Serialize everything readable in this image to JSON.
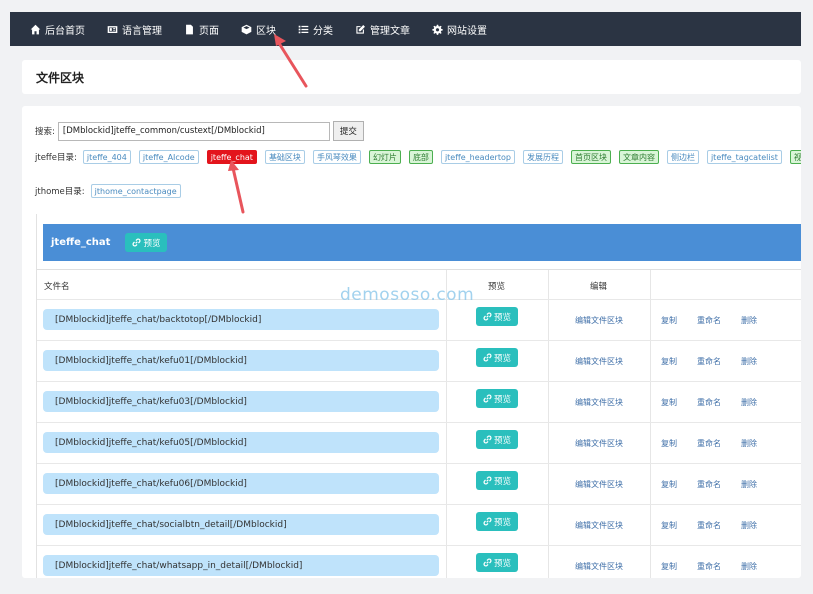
{
  "nav": [
    {
      "label": "后台首页",
      "icon": "home-icon"
    },
    {
      "label": "语言管理",
      "icon": "language-icon"
    },
    {
      "label": "页面",
      "icon": "page-icon"
    },
    {
      "label": "区块",
      "icon": "cube-icon"
    },
    {
      "label": "分类",
      "icon": "list-icon"
    },
    {
      "label": "管理文章",
      "icon": "edit-icon"
    },
    {
      "label": "网站设置",
      "icon": "gear-icon"
    }
  ],
  "page_title": "文件区块",
  "search": {
    "label": "搜索:",
    "value": "[DMblockid]jteffe_common/custext[/DMblockid]",
    "button": "提交"
  },
  "jteffe_dir": {
    "label": "jteffe目录:",
    "tags": [
      {
        "label": "jteffe_404",
        "style": "plain"
      },
      {
        "label": "jteffe_AIcode",
        "style": "plain"
      },
      {
        "label": "jteffe_chat",
        "style": "active"
      },
      {
        "label": "基础区块",
        "style": "plain"
      },
      {
        "label": "手风琴效果",
        "style": "plain"
      },
      {
        "label": "幻灯片",
        "style": "green"
      },
      {
        "label": "底部",
        "style": "green"
      },
      {
        "label": "jteffe_headertop",
        "style": "plain"
      },
      {
        "label": "发展历程",
        "style": "plain"
      },
      {
        "label": "首页区块",
        "style": "green"
      },
      {
        "label": "文章内容",
        "style": "green"
      },
      {
        "label": "侧边栏",
        "style": "plain"
      },
      {
        "label": "jteffe_tagcatelist",
        "style": "plain"
      },
      {
        "label": "视频",
        "style": "green"
      }
    ]
  },
  "jthome_dir": {
    "label": "jthome目录:",
    "tags": [
      {
        "label": "jthome_contactpage",
        "style": "plain"
      }
    ]
  },
  "panel": {
    "title": "jteffe_chat",
    "preview_label": "预览"
  },
  "table": {
    "headers": {
      "name": "文件名",
      "preview": "预览",
      "edit": "编辑",
      "actions": ""
    },
    "rows": [
      {
        "name": "[DMblockid]jteffe_chat/backtotop[/DMblockid]",
        "preview": "预览",
        "edit": "编辑文件区块",
        "copy": "复制",
        "rename": "重命名",
        "delete": "删除"
      },
      {
        "name": "[DMblockid]jteffe_chat/kefu01[/DMblockid]",
        "preview": "预览",
        "edit": "编辑文件区块",
        "copy": "复制",
        "rename": "重命名",
        "delete": "删除"
      },
      {
        "name": "[DMblockid]jteffe_chat/kefu03[/DMblockid]",
        "preview": "预览",
        "edit": "编辑文件区块",
        "copy": "复制",
        "rename": "重命名",
        "delete": "删除"
      },
      {
        "name": "[DMblockid]jteffe_chat/kefu05[/DMblockid]",
        "preview": "预览",
        "edit": "编辑文件区块",
        "copy": "复制",
        "rename": "重命名",
        "delete": "删除"
      },
      {
        "name": "[DMblockid]jteffe_chat/kefu06[/DMblockid]",
        "preview": "预览",
        "edit": "编辑文件区块",
        "copy": "复制",
        "rename": "重命名",
        "delete": "删除"
      },
      {
        "name": "[DMblockid]jteffe_chat/socialbtn_detail[/DMblockid]",
        "preview": "预览",
        "edit": "编辑文件区块",
        "copy": "复制",
        "rename": "重命名",
        "delete": "删除"
      },
      {
        "name": "[DMblockid]jteffe_chat/whatsapp_in_detail[/DMblockid]",
        "preview": "预览",
        "edit": "编辑文件区块",
        "copy": "复制",
        "rename": "重命名",
        "delete": "删除"
      }
    ]
  },
  "watermark": "demososo.com",
  "colors": {
    "nav_bg": "#2b3443",
    "panel_head": "#4a8ed6",
    "teal_button": "#2abfbd",
    "active_tag": "#e3141c",
    "filename_bg": "#bfe3fb",
    "arrow": "#e8555c"
  }
}
